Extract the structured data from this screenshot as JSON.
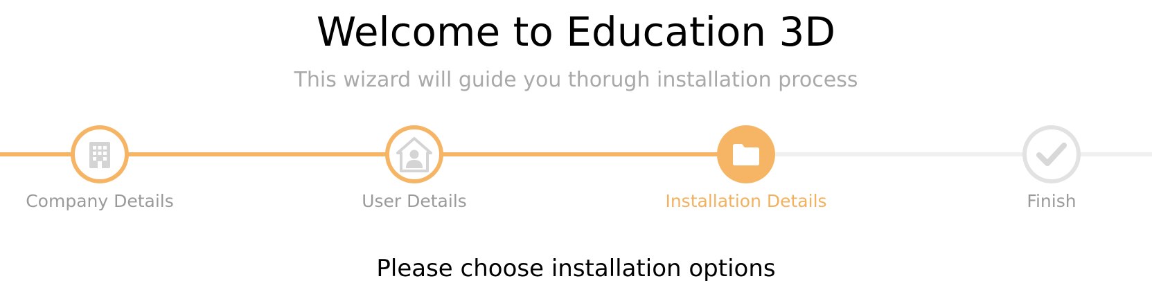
{
  "header": {
    "title": "Welcome to Education 3D",
    "subtitle": "This wizard will guide you thorugh installation process"
  },
  "wizard": {
    "steps": [
      {
        "label": "Company Details",
        "icon": "building-icon",
        "state": "completed"
      },
      {
        "label": "User Details",
        "icon": "user-home-icon",
        "state": "completed"
      },
      {
        "label": "Installation Details",
        "icon": "folder-icon",
        "state": "active"
      },
      {
        "label": "Finish",
        "icon": "checkmark-icon",
        "state": "pending"
      }
    ],
    "colors": {
      "accent": "#f6b565",
      "inactive": "#e2e2e2",
      "label": "#9a9a9a"
    }
  },
  "main": {
    "prompt": "Please choose installation options"
  }
}
